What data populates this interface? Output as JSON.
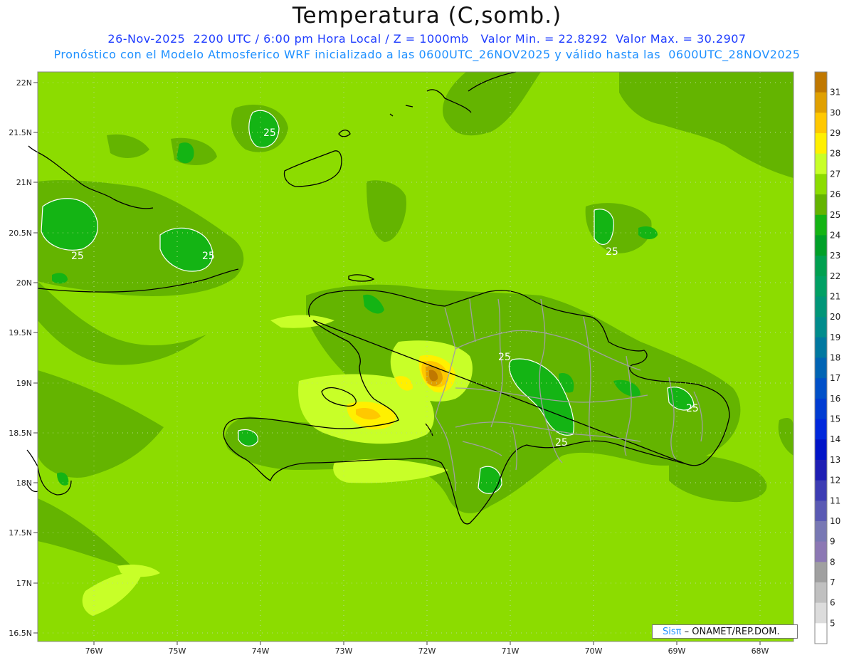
{
  "title": "Temperatura (C,somb.)",
  "subtitle_line1": "26-Nov-2025  2200 UTC / 6:00 pm Hora Local / Z = 1000mb   Valor Min. = 22.8292  Valor Max. = 30.2907",
  "subtitle_line2": "Pronóstico con el Modelo Atmosferico WRF inicializado a las 0600UTC_26NOV2025 y válido hasta las  0600UTC_28NOV2025",
  "credit": {
    "prefix": "Sisπ",
    "suffix": " – ONAMET/REP.DOM."
  },
  "lat_labels": [
    "22N",
    "21.5N",
    "21N",
    "20.5N",
    "20N",
    "19.5N",
    "19N",
    "18.5N",
    "18N",
    "17.5N",
    "17N",
    "16.5N"
  ],
  "lon_labels": [
    "76W",
    "75W",
    "74W",
    "73W",
    "72W",
    "71W",
    "70W",
    "69W",
    "68W"
  ],
  "contour_labels": [
    "25",
    "25",
    "25",
    "25",
    "25",
    "25",
    "25"
  ],
  "colorbar": [
    {
      "label": "31",
      "color": "#c07800"
    },
    {
      "label": "30",
      "color": "#e0a000"
    },
    {
      "label": "29",
      "color": "#ffc800"
    },
    {
      "label": "28",
      "color": "#fff000"
    },
    {
      "label": "27",
      "color": "#c8ff28"
    },
    {
      "label": "26",
      "color": "#8cdc00"
    },
    {
      "label": "25",
      "color": "#64b400"
    },
    {
      "label": "24",
      "color": "#14b414"
    },
    {
      "label": "23",
      "color": "#00a028"
    },
    {
      "label": "22",
      "color": "#00a050"
    },
    {
      "label": "21",
      "color": "#00a064"
    },
    {
      "label": "20",
      "color": "#009678"
    },
    {
      "label": "19",
      "color": "#008c8c"
    },
    {
      "label": "18",
      "color": "#0078a0"
    },
    {
      "label": "17",
      "color": "#0064b4"
    },
    {
      "label": "16",
      "color": "#0050c8"
    },
    {
      "label": "15",
      "color": "#003cd2"
    },
    {
      "label": "14",
      "color": "#0028dc"
    },
    {
      "label": "13",
      "color": "#0014c8"
    },
    {
      "label": "12",
      "color": "#1e1eb4"
    },
    {
      "label": "11",
      "color": "#3c3cb4"
    },
    {
      "label": "10",
      "color": "#5a5ab4"
    },
    {
      "label": "9",
      "color": "#7878b4"
    },
    {
      "label": "8",
      "color": "#8c78b4"
    },
    {
      "label": "7",
      "color": "#a0a0a0"
    },
    {
      "label": "6",
      "color": "#c0c0c0"
    },
    {
      "label": "5",
      "color": "#dcdcdc"
    },
    {
      "label": "",
      "color": "#ffffff"
    }
  ],
  "colors": {
    "base_26": "#8cdc00",
    "band_25": "#64b400",
    "band_24": "#14b414",
    "band_27": "#c8ff28",
    "band_28": "#fff000",
    "band_29": "#ffc800",
    "band_30": "#e0a000",
    "band_31": "#c07800",
    "coast": "#000000",
    "borders": "#a0a0a0"
  }
}
